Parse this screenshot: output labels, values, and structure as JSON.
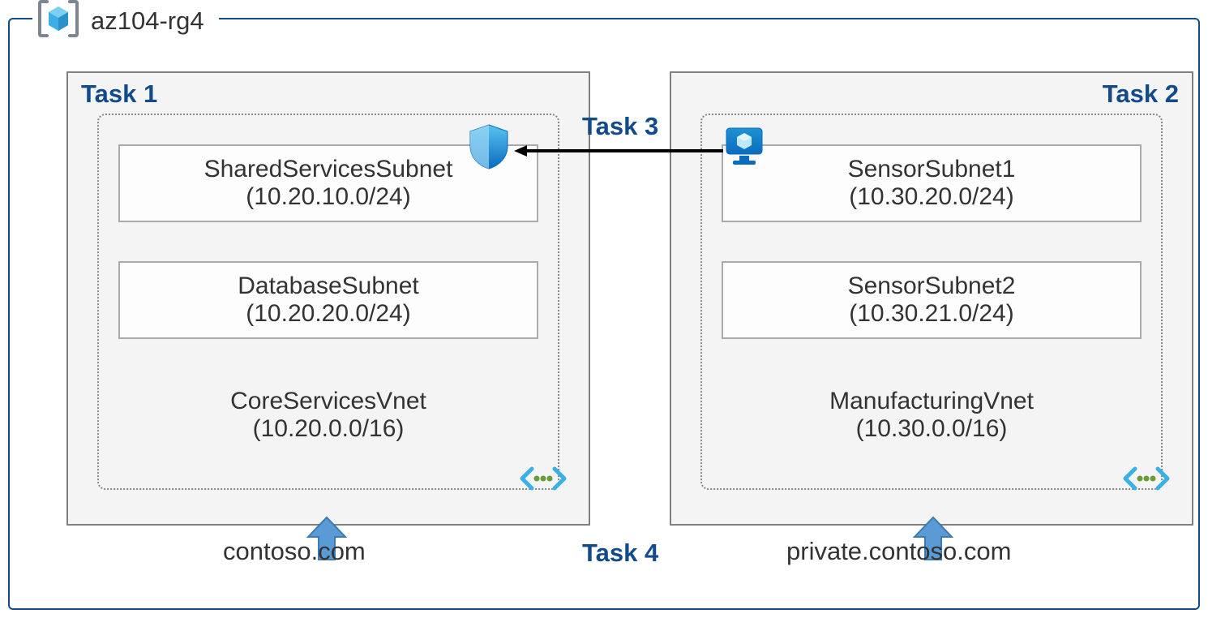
{
  "resource_group": "az104-rg4",
  "task1": {
    "title": "Task 1",
    "vnet": {
      "name": "CoreServicesVnet",
      "cidr": "(10.20.0.0/16)"
    },
    "subnets": [
      {
        "name": "SharedServicesSubnet",
        "cidr": "(10.20.10.0/24)"
      },
      {
        "name": "DatabaseSubnet",
        "cidr": "(10.20.20.0/24)"
      }
    ],
    "dns": "contoso.com"
  },
  "task2": {
    "title": "Task 2",
    "vnet": {
      "name": "ManufacturingVnet",
      "cidr": "(10.30.0.0/16)"
    },
    "subnets": [
      {
        "name": "SensorSubnet1",
        "cidr": "(10.30.20.0/24)"
      },
      {
        "name": "SensorSubnet2",
        "cidr": "(10.30.21.0/24)"
      }
    ],
    "dns": "private.contoso.com"
  },
  "task3": {
    "title": "Task 3"
  },
  "task4": {
    "title": "Task 4"
  },
  "icons": {
    "resource_group_brackets": "resource-group",
    "vnet": "virtual-network",
    "shield": "network-security-group",
    "monitor": "application-security-group",
    "arrow_up": "arrow-up"
  },
  "colors": {
    "outline_navy": "#134b8a",
    "box_gray": "#f4f4f4",
    "border_gray": "#7f7f7f",
    "azure_blue": "#3a9be0",
    "arrow_blue": "#5b9bd5"
  }
}
